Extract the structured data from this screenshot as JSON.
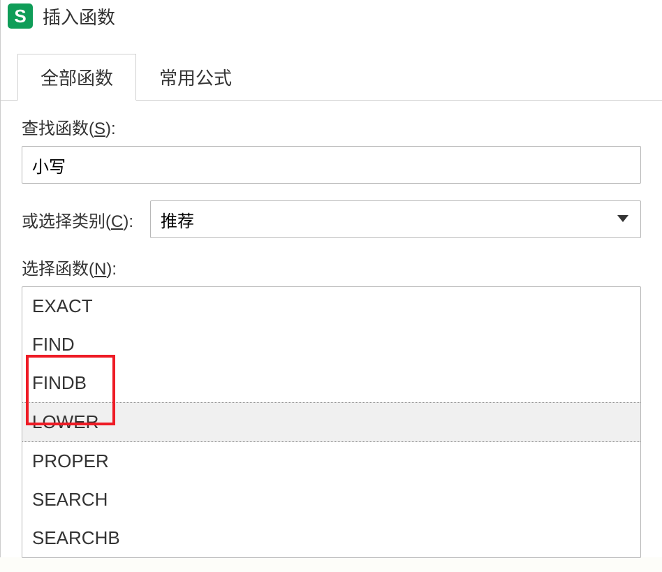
{
  "dialog": {
    "title": "插入函数",
    "app_icon_letter": "S"
  },
  "tabs": {
    "all_functions": "全部函数",
    "common_formulas": "常用公式"
  },
  "search": {
    "label_prefix": "查找函数(",
    "label_key": "S",
    "label_suffix": "):",
    "value": "小写"
  },
  "category": {
    "label_prefix": "或选择类别(",
    "label_key": "C",
    "label_suffix": "):",
    "selected": "推荐"
  },
  "function_select": {
    "label_prefix": "选择函数(",
    "label_key": "N",
    "label_suffix": "):"
  },
  "functions": [
    "EXACT",
    "FIND",
    "FINDB",
    "LOWER",
    "PROPER",
    "SEARCH",
    "SEARCHB"
  ],
  "selected_function_index": 3
}
